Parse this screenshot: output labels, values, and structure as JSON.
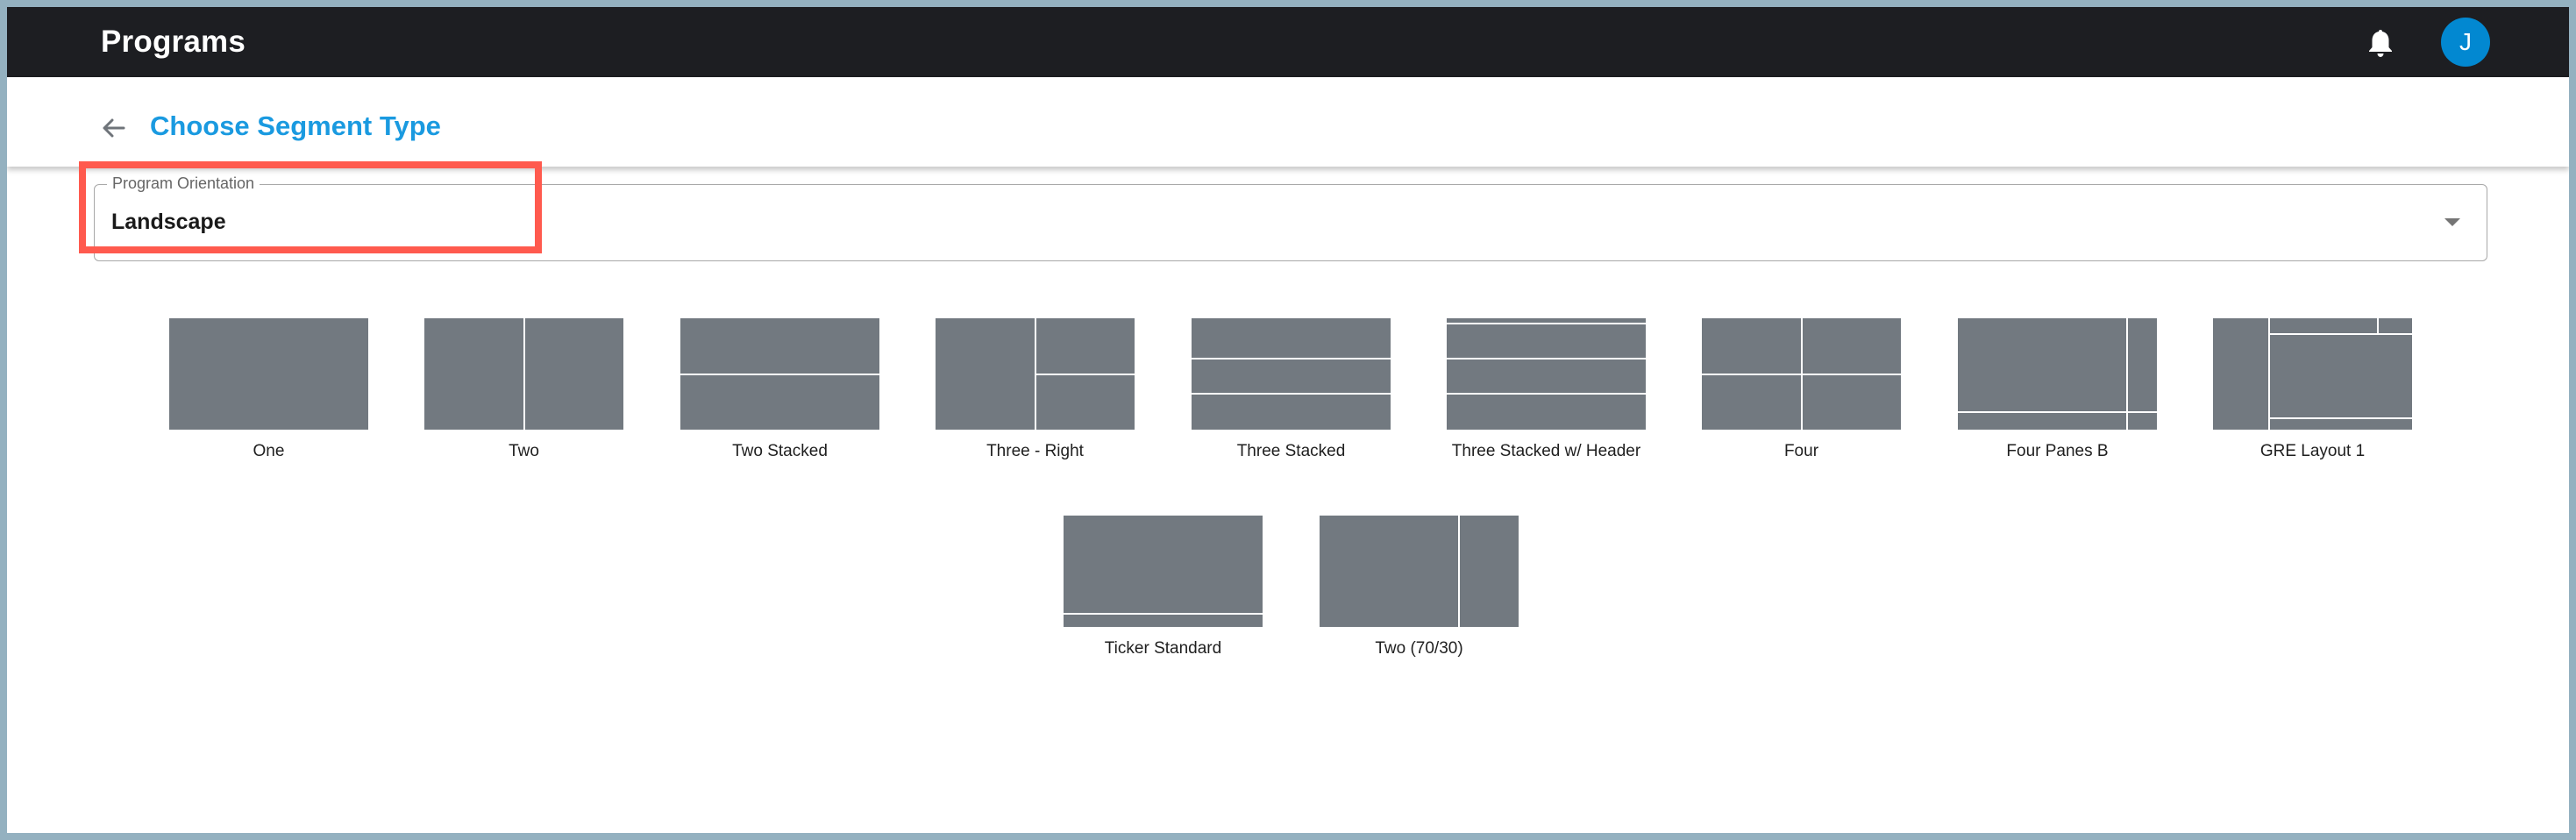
{
  "header": {
    "app_title": "Programs",
    "notification_icon": "bell-icon",
    "avatar_initial": "J",
    "avatar_color": "#0288d1"
  },
  "subheader": {
    "back_icon": "arrow-left-icon",
    "title": "Choose Segment Type",
    "title_color": "#1a9ae0"
  },
  "orientation_select": {
    "label": "Program Orientation",
    "value": "Landscape",
    "caret_icon": "caret-down-icon",
    "highlighted": true,
    "highlight_color": "#ff5a4e"
  },
  "segment_types": [
    {
      "label": "One",
      "panes": [
        [
          0,
          0,
          1,
          1
        ]
      ]
    },
    {
      "label": "Two",
      "panes": [
        [
          0,
          0,
          0.5,
          1
        ],
        [
          0.5,
          0,
          0.5,
          1
        ]
      ]
    },
    {
      "label": "Two Stacked",
      "panes": [
        [
          0,
          0,
          1,
          0.5
        ],
        [
          0,
          0.5,
          1,
          0.5
        ]
      ]
    },
    {
      "label": "Three - Right",
      "panes": [
        [
          0,
          0,
          0.5,
          1
        ],
        [
          0.5,
          0,
          0.5,
          0.5
        ],
        [
          0.5,
          0.5,
          0.5,
          0.5
        ]
      ]
    },
    {
      "label": "Three Stacked",
      "panes": [
        [
          0,
          0,
          1,
          0.36
        ],
        [
          0,
          0.36,
          1,
          0.32
        ],
        [
          0,
          0.68,
          1,
          0.32
        ]
      ]
    },
    {
      "label": "Three Stacked w/ Header",
      "panes": [
        [
          0,
          0,
          1,
          0.05
        ],
        [
          0,
          0.05,
          1,
          0.31
        ],
        [
          0,
          0.36,
          1,
          0.32
        ],
        [
          0,
          0.68,
          1,
          0.32
        ]
      ]
    },
    {
      "label": "Four",
      "panes": [
        [
          0,
          0,
          0.5,
          0.5
        ],
        [
          0.5,
          0,
          0.5,
          0.5
        ],
        [
          0,
          0.5,
          0.5,
          0.5
        ],
        [
          0.5,
          0.5,
          0.5,
          0.5
        ]
      ]
    },
    {
      "label": "Four Panes B",
      "panes": [
        [
          0,
          0,
          0.85,
          0.84
        ],
        [
          0.85,
          0,
          0.15,
          0.84
        ],
        [
          0,
          0.84,
          0.85,
          0.16
        ],
        [
          0.85,
          0.84,
          0.15,
          0.16
        ]
      ]
    },
    {
      "label": "GRE Layout 1",
      "panes": [
        [
          0,
          0,
          0.28,
          1
        ],
        [
          0.28,
          0,
          0.55,
          0.14
        ],
        [
          0.83,
          0,
          0.17,
          0.14
        ],
        [
          0.28,
          0.14,
          0.72,
          0.76
        ],
        [
          0.28,
          0.9,
          0.72,
          0.1
        ]
      ]
    },
    {
      "label": "Ticker Standard",
      "panes": [
        [
          0,
          0,
          1,
          0.88
        ],
        [
          0,
          0.88,
          1,
          0.12
        ]
      ]
    },
    {
      "label": "Two (70/30)",
      "panes": [
        [
          0,
          0,
          0.7,
          1
        ],
        [
          0.7,
          0,
          0.3,
          1
        ]
      ]
    }
  ],
  "pane_color": "#727980"
}
